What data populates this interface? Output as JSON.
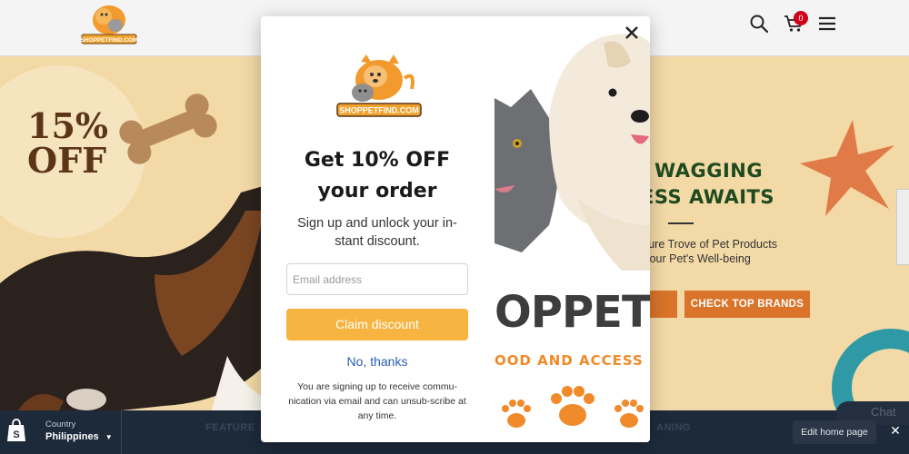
{
  "header": {
    "logo_text": "SHOPPETFIND.COM",
    "cart_count": "0",
    "icons": [
      "search-icon",
      "cart-icon",
      "menu-icon"
    ]
  },
  "hero": {
    "promo_line1": "15%",
    "promo_line2": "OFF",
    "title_line1": "WAGGING",
    "title_line2": "ESS AWAITS",
    "subtitle_line1": "asure Trove of Pet Products",
    "subtitle_line2": "r Your Pet's Well-being",
    "button_2": "CHECK TOP BRANDS"
  },
  "modal": {
    "logo_text": "SHOPPETFIND.COM",
    "title": "Get 10% OFF your order",
    "subtitle": "Sign up and unlock your in-stant discount.",
    "email_placeholder": "Email address",
    "claim_button": "Claim discount",
    "no_thanks": "No, thanks",
    "fine_print": "You are signing up to receive commu-nication via email and can unsub-scribe at any time.",
    "art_brand": "OPPETF",
    "art_tagline": "OOD AND ACCESS"
  },
  "bottom_bar": {
    "country_label": "Country",
    "country_value": "Philippines",
    "featured_text": "FEATURE",
    "right_text": "ANING",
    "edit_button": "Edit home page",
    "chat_text": "Chat"
  },
  "colors": {
    "accent_orange": "#f7b440",
    "hero_button": "#d9742a",
    "hero_title": "#1f4a20",
    "link_blue": "#2a5db0",
    "badge_red": "#d0021b",
    "bar_navy": "#1d2a3a"
  }
}
